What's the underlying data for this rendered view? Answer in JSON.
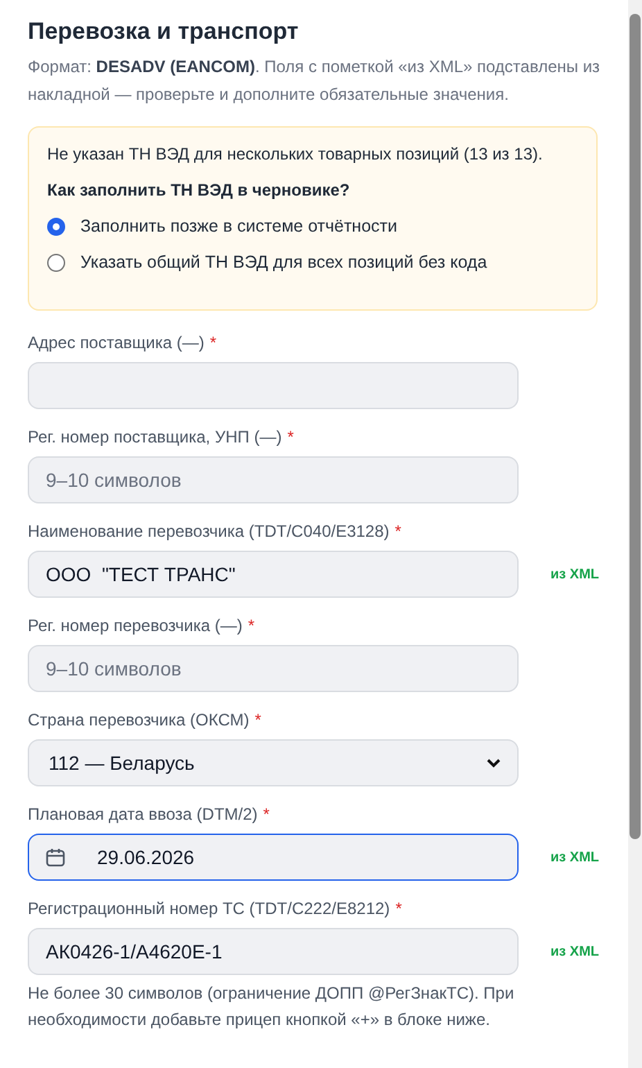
{
  "title": "Перевозка и транспорт",
  "description": "Формат: **DESADV (EANCOM)**. Поля с пометкой «из XML» подставлены из накладной — проверьте и дополните обязательные значения.",
  "warning": {
    "message": "Не указан ТН ВЭД для нескольких товарных позиций (13 из 13).",
    "question": "Как заполнить ТН ВЭД в черновике?",
    "options": [
      {
        "label": "Заполнить позже в системе отчётности",
        "selected": true
      },
      {
        "label": "Указать общий ТН ВЭД для всех позиций без кода",
        "selected": false
      }
    ]
  },
  "fields": [
    {
      "kind": "text",
      "label": "Адрес поставщика (—)",
      "required_mark": "*"
    },
    {
      "kind": "text",
      "label": "Рег. номер поставщика, УНП (—)",
      "required_mark": "*",
      "placeholder": "9–10 символов"
    },
    {
      "kind": "text",
      "label": "Наименование перевозчика (TDT/C040/E3128)",
      "required_mark": "*",
      "value": "ООО  \"ТЕСТ ТРАНС\"",
      "badge": "из XML"
    },
    {
      "kind": "text",
      "label": "Рег. номер перевозчика (—)",
      "required_mark": "*",
      "placeholder": "9–10 символов"
    },
    {
      "kind": "select",
      "label": "Страна перевозчика (ОКСМ)",
      "required_mark": "*",
      "value": "112 — Беларусь"
    },
    {
      "kind": "date",
      "label": "Плановая дата ввоза (DTM/2)",
      "required_mark": "*",
      "value": "29.06.2026",
      "focused": true,
      "badge": "из XML"
    },
    {
      "kind": "text",
      "label": "Регистрационный номер ТС (TDT/C222/E8212)",
      "required_mark": "*",
      "value": "АК0426-1/А4620Е-1",
      "badge": "из XML",
      "hint": "Не более 30 символов (ограничение ДОПП @РегЗнакТС). При необходимости добавьте прицеп кнопкой «+» в блоке ниже."
    }
  ]
}
